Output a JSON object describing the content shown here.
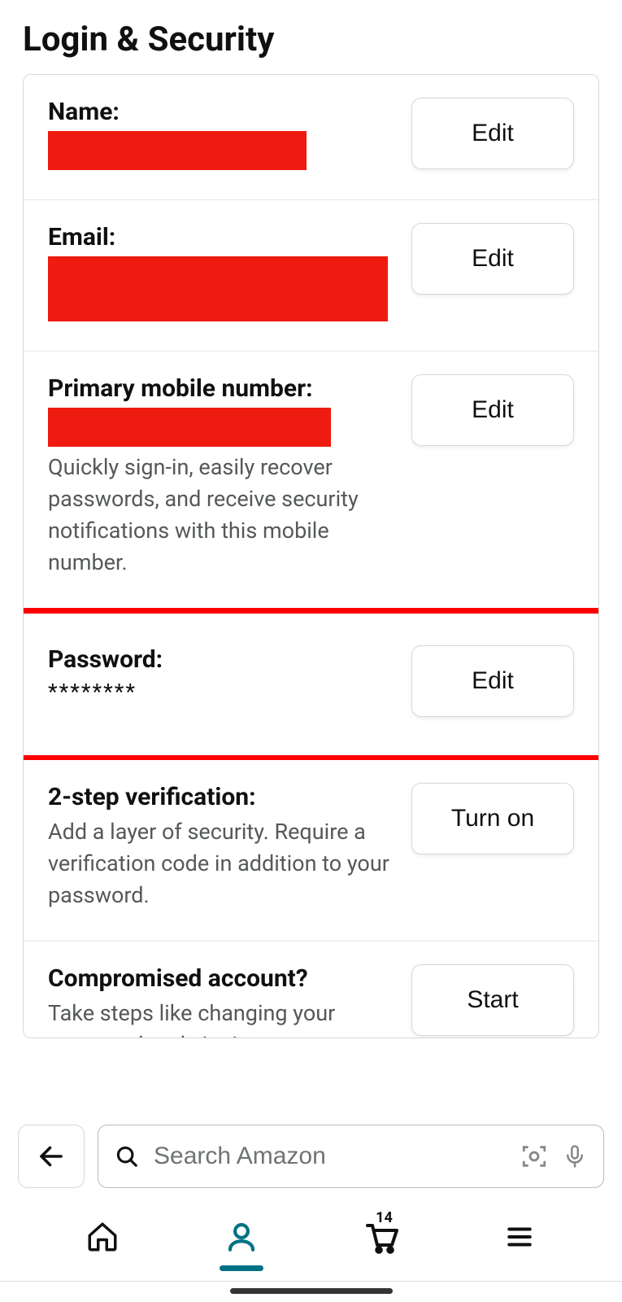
{
  "title": "Login & Security",
  "rows": {
    "name": {
      "label": "Name:",
      "button": "Edit"
    },
    "email": {
      "label": "Email:",
      "button": "Edit"
    },
    "phone": {
      "label": "Primary mobile number:",
      "button": "Edit",
      "desc": "Quickly sign-in, easily recover passwords, and receive security notifications with this mobile number."
    },
    "password": {
      "label": "Password:",
      "value": "********",
      "button": "Edit"
    },
    "twostep": {
      "label": "2-step verification:",
      "button": "Turn on",
      "desc": "Add a layer of security. Require a verification code in addition to your password."
    },
    "compromised": {
      "label": "Compromised account?",
      "button": "Start",
      "desc": "Take steps like changing your password and signing"
    }
  },
  "search": {
    "placeholder": "Search Amazon"
  },
  "cart_count": "14"
}
